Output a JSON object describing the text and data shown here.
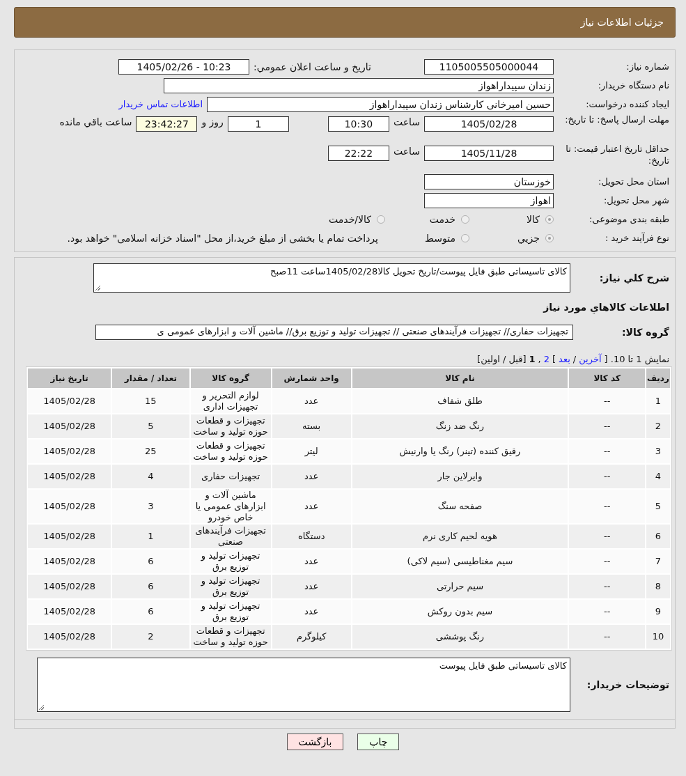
{
  "header": {
    "title": "جزئیات اطلاعات نیاز"
  },
  "form": {
    "need_number": {
      "label": "شماره نیاز:",
      "value": "1105005505000044"
    },
    "announce": {
      "label": "تاریخ و ساعت اعلان عمومي:",
      "value": "1405/02/26 - 10:23"
    },
    "buyer_org": {
      "label": "نام دستگاه خريدار:",
      "value": "زندان سپیداراهواز"
    },
    "creator": {
      "label": "ايجاد کننده درخواست:",
      "value": "حسین امیرخانی کارشناس زندان سپیداراهواز",
      "link": "اطلاعات تماس خريدار"
    },
    "deadline": {
      "label": "مهلت ارسال پاسخ: تا تاریخ:",
      "date": "1405/02/28",
      "time_label": "ساعت",
      "time": "10:30",
      "days": "1",
      "days_label": "روز و",
      "remaining": "23:42:27",
      "remaining_label": "ساعت باقي مانده"
    },
    "validity": {
      "label": "حداقل تاریخ اعتبار قيمت: تا تاریخ:",
      "date": "1405/11/28",
      "time_label": "ساعت",
      "time": "22:22"
    },
    "province": {
      "label": "استان محل تحويل:",
      "value": "خوزستان"
    },
    "city": {
      "label": "شهر محل تحويل:",
      "value": "اهواز"
    },
    "category": {
      "label": "طبقه بندی موضوعی:",
      "options": [
        {
          "label": "کالا",
          "selected": true
        },
        {
          "label": "خدمت",
          "selected": false
        },
        {
          "label": "کالا/خدمت",
          "selected": false
        }
      ]
    },
    "process": {
      "label": "نوع فرآيند خريد :",
      "options": [
        {
          "label": "جزيي",
          "selected": true
        },
        {
          "label": "متوسط",
          "selected": false
        }
      ],
      "note": "پرداخت تمام یا بخشی از مبلغ خرید،از محل \"اسناد خزانه اسلامی\" خواهد بود."
    }
  },
  "description": {
    "label": "شرح کلي نياز:",
    "value": "کالای تاسیساتی طبق فایل پیوست/تاریخ تحویل کالا1405/02/28ساعت 11صبح"
  },
  "goods_heading": "اطلاعات کالاهاي مورد نياز",
  "goods_group": {
    "label": "گروه کالا:",
    "value": "تجهیزات حفاری// تجهیزات فرآیندهای صنعتی // تجهیزات تولید و توزیع برق//  ماشین آلات و ابزارهای عمومی ی"
  },
  "pagination": [
    {
      "kind": "text",
      "text": "نمایش 1 تا 10. ["
    },
    {
      "kind": "link",
      "text": "آخرین"
    },
    {
      "kind": "text",
      "text": "/"
    },
    {
      "kind": "link",
      "text": "بعد"
    },
    {
      "kind": "text",
      "text": "]"
    },
    {
      "kind": "link",
      "text": "2"
    },
    {
      "kind": "text",
      "text": ","
    },
    {
      "kind": "current",
      "text": "1"
    },
    {
      "kind": "text",
      "text": "[قبل / اولین]"
    }
  ],
  "table": {
    "columns": [
      "ردیف",
      "کد کالا",
      "نام کالا",
      "واحد شمارش",
      "گروه کالا",
      "تعداد / مقدار",
      "تاریخ نیاز"
    ],
    "rows": [
      [
        "1",
        "--",
        "طلق شفاف",
        "عدد",
        "لوازم التحریر و تجهیزات اداری",
        "15",
        "1405/02/28"
      ],
      [
        "2",
        "--",
        "رنگ ضد زنگ",
        "بسته",
        "تجهیزات و قطعات حوزه تولید و ساخت",
        "5",
        "1405/02/28"
      ],
      [
        "3",
        "--",
        "رقیق کننده (تینر) رنگ یا وارنیش",
        "لیتر",
        "تجهیزات و قطعات حوزه تولید و ساخت",
        "25",
        "1405/02/28"
      ],
      [
        "4",
        "--",
        "وایرلاین جار",
        "عدد",
        "تجهیزات حفاری",
        "4",
        "1405/02/28"
      ],
      [
        "5",
        "--",
        "صفحه سنگ",
        "عدد",
        "ماشین آلات و ابزارهای عمومی یا خاص خودرو",
        "3",
        "1405/02/28"
      ],
      [
        "6",
        "--",
        "هویه لحیم کاری نرم",
        "دستگاه",
        "تجهیزات فرآیندهای صنعتی",
        "1",
        "1405/02/28"
      ],
      [
        "7",
        "--",
        "سیم مغناطیسی (سیم لاکی)",
        "عدد",
        "تجهیزات تولید و توزیع برق",
        "6",
        "1405/02/28"
      ],
      [
        "8",
        "--",
        "سیم حرارتی",
        "عدد",
        "تجهیزات تولید و توزیع برق",
        "6",
        "1405/02/28"
      ],
      [
        "9",
        "--",
        "سیم بدون روکش",
        "عدد",
        "تجهیزات تولید و توزیع برق",
        "6",
        "1405/02/28"
      ],
      [
        "10",
        "--",
        "رنگ پوششی",
        "کیلوگرم",
        "تجهیزات و قطعات حوزه تولید و ساخت",
        "2",
        "1405/02/28"
      ]
    ]
  },
  "buyer_notes": {
    "label": "توضيحات خريدار:",
    "value": "کالای تاسیساتی طبق فایل پیوست"
  },
  "buttons": [
    {
      "label": "چاپ",
      "kind": "print"
    },
    {
      "label": "بازگشت",
      "kind": "back"
    }
  ]
}
